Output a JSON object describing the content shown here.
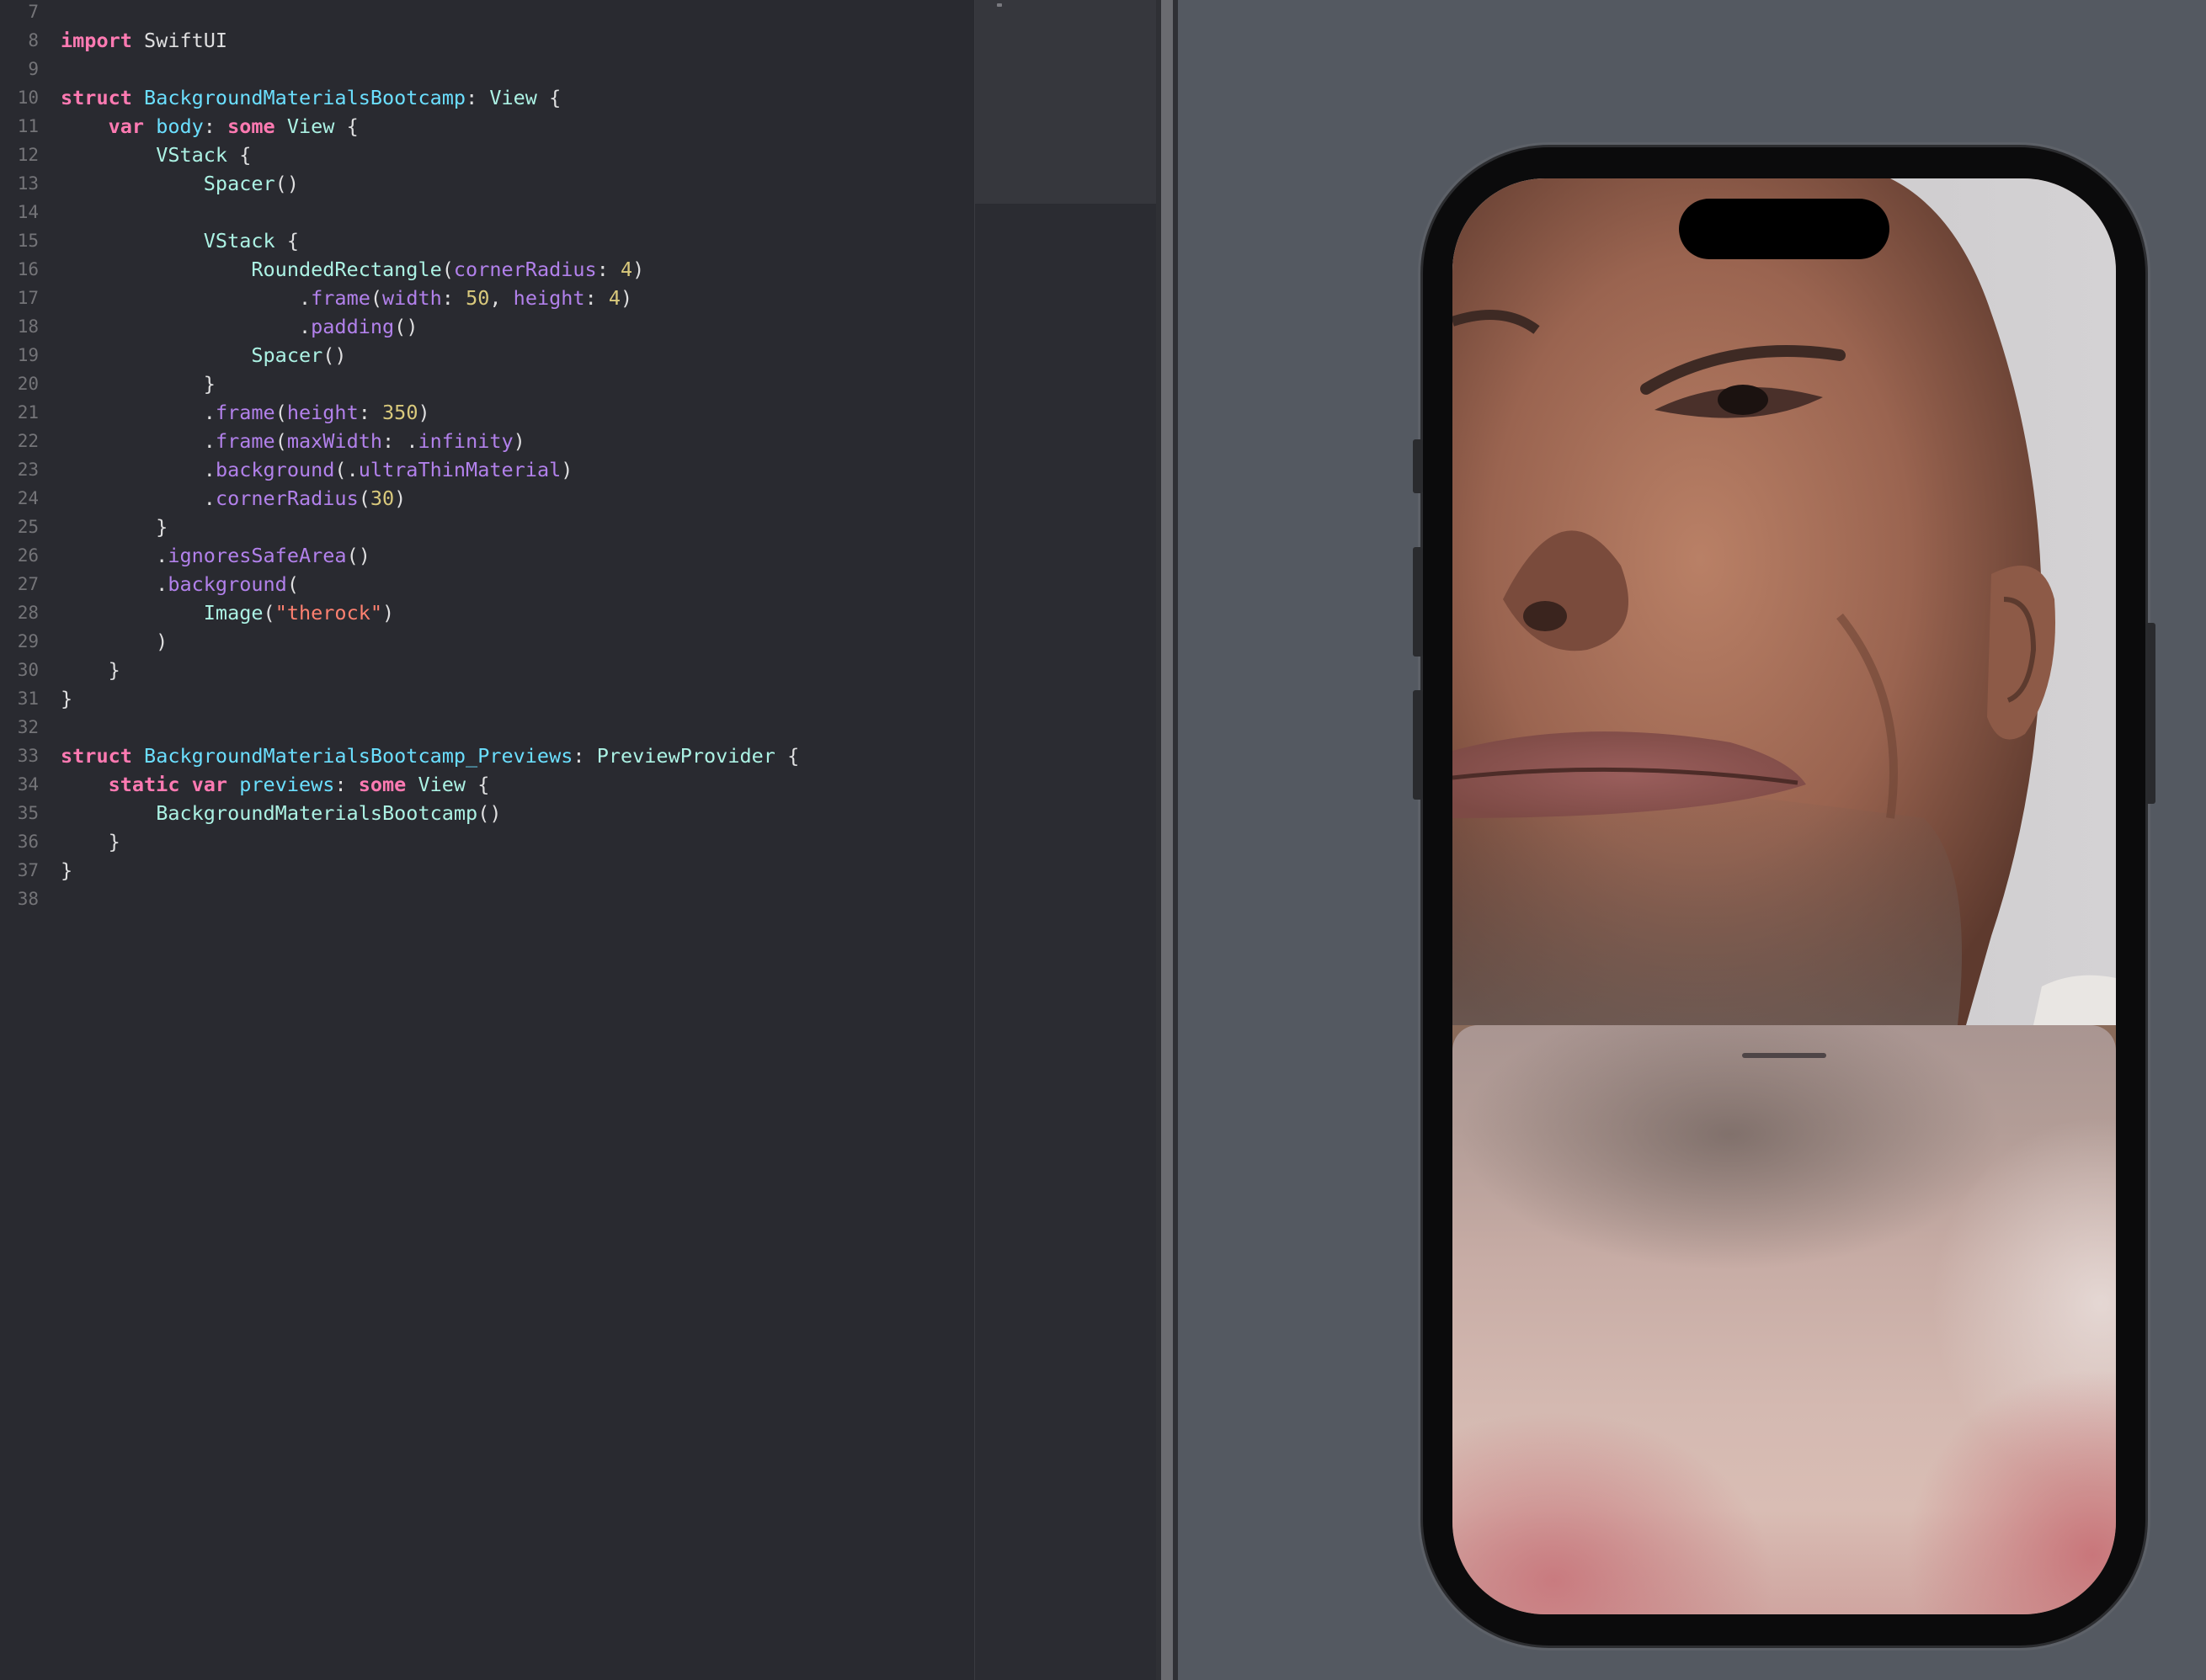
{
  "editor": {
    "lines": [
      {
        "n": "7",
        "tokens": []
      },
      {
        "n": "8",
        "tokens": [
          [
            "kw",
            "import"
          ],
          [
            "p",
            " SwiftUI"
          ]
        ]
      },
      {
        "n": "9",
        "tokens": []
      },
      {
        "n": "10",
        "tokens": [
          [
            "kw",
            "struct"
          ],
          [
            "p",
            " "
          ],
          [
            "tp",
            "BackgroundMaterialsBootcamp"
          ],
          [
            "p",
            ": "
          ],
          [
            "cls",
            "View"
          ],
          [
            "p",
            " {"
          ]
        ]
      },
      {
        "n": "11",
        "tokens": [
          [
            "p",
            "    "
          ],
          [
            "kw",
            "var"
          ],
          [
            "p",
            " "
          ],
          [
            "tp",
            "body"
          ],
          [
            "p",
            ": "
          ],
          [
            "kw",
            "some"
          ],
          [
            "p",
            " "
          ],
          [
            "cls",
            "View"
          ],
          [
            "p",
            " {"
          ]
        ]
      },
      {
        "n": "12",
        "tokens": [
          [
            "p",
            "        "
          ],
          [
            "cls",
            "VStack"
          ],
          [
            "p",
            " {"
          ]
        ]
      },
      {
        "n": "13",
        "tokens": [
          [
            "p",
            "            "
          ],
          [
            "cls",
            "Spacer"
          ],
          [
            "p",
            "()"
          ]
        ]
      },
      {
        "n": "14",
        "tokens": []
      },
      {
        "n": "15",
        "tokens": [
          [
            "p",
            "            "
          ],
          [
            "cls",
            "VStack"
          ],
          [
            "p",
            " {"
          ]
        ]
      },
      {
        "n": "16",
        "tokens": [
          [
            "p",
            "                "
          ],
          [
            "cls",
            "RoundedRectangle"
          ],
          [
            "p",
            "("
          ],
          [
            "mt",
            "cornerRadius"
          ],
          [
            "p",
            ": "
          ],
          [
            "num",
            "4"
          ],
          [
            "p",
            ")"
          ]
        ]
      },
      {
        "n": "17",
        "tokens": [
          [
            "p",
            "                    ."
          ],
          [
            "mt",
            "frame"
          ],
          [
            "p",
            "("
          ],
          [
            "mt",
            "width"
          ],
          [
            "p",
            ": "
          ],
          [
            "num",
            "50"
          ],
          [
            "p",
            ", "
          ],
          [
            "mt",
            "height"
          ],
          [
            "p",
            ": "
          ],
          [
            "num",
            "4"
          ],
          [
            "p",
            ")"
          ]
        ]
      },
      {
        "n": "18",
        "tokens": [
          [
            "p",
            "                    ."
          ],
          [
            "mt",
            "padding"
          ],
          [
            "p",
            "()"
          ]
        ]
      },
      {
        "n": "19",
        "tokens": [
          [
            "p",
            "                "
          ],
          [
            "cls",
            "Spacer"
          ],
          [
            "p",
            "()"
          ]
        ]
      },
      {
        "n": "20",
        "tokens": [
          [
            "p",
            "            }"
          ]
        ]
      },
      {
        "n": "21",
        "tokens": [
          [
            "p",
            "            ."
          ],
          [
            "mt",
            "frame"
          ],
          [
            "p",
            "("
          ],
          [
            "mt",
            "height"
          ],
          [
            "p",
            ": "
          ],
          [
            "num",
            "350"
          ],
          [
            "p",
            ")"
          ]
        ]
      },
      {
        "n": "22",
        "tokens": [
          [
            "p",
            "            ."
          ],
          [
            "mt",
            "frame"
          ],
          [
            "p",
            "("
          ],
          [
            "mt",
            "maxWidth"
          ],
          [
            "p",
            ": ."
          ],
          [
            "mt",
            "infinity"
          ],
          [
            "p",
            ")"
          ]
        ]
      },
      {
        "n": "23",
        "tokens": [
          [
            "p",
            "            ."
          ],
          [
            "mt",
            "background"
          ],
          [
            "p",
            "(."
          ],
          [
            "mt",
            "ultraThinMaterial"
          ],
          [
            "p",
            ")"
          ]
        ]
      },
      {
        "n": "24",
        "tokens": [
          [
            "p",
            "            ."
          ],
          [
            "mt",
            "cornerRadius"
          ],
          [
            "p",
            "("
          ],
          [
            "num",
            "30"
          ],
          [
            "p",
            ")"
          ]
        ]
      },
      {
        "n": "25",
        "tokens": [
          [
            "p",
            "        }"
          ]
        ]
      },
      {
        "n": "26",
        "tokens": [
          [
            "p",
            "        ."
          ],
          [
            "mt",
            "ignoresSafeArea"
          ],
          [
            "p",
            "()"
          ]
        ]
      },
      {
        "n": "27",
        "tokens": [
          [
            "p",
            "        ."
          ],
          [
            "mt",
            "background"
          ],
          [
            "p",
            "("
          ]
        ]
      },
      {
        "n": "28",
        "tokens": [
          [
            "p",
            "            "
          ],
          [
            "cls",
            "Image"
          ],
          [
            "p",
            "("
          ],
          [
            "str",
            "\"therock\""
          ],
          [
            "p",
            ")"
          ]
        ]
      },
      {
        "n": "29",
        "tokens": [
          [
            "p",
            "        )"
          ]
        ]
      },
      {
        "n": "30",
        "tokens": [
          [
            "p",
            "    }"
          ]
        ]
      },
      {
        "n": "31",
        "tokens": [
          [
            "p",
            "}"
          ]
        ]
      },
      {
        "n": "32",
        "tokens": []
      },
      {
        "n": "33",
        "tokens": [
          [
            "kw",
            "struct"
          ],
          [
            "p",
            " "
          ],
          [
            "tp",
            "BackgroundMaterialsBootcamp_Previews"
          ],
          [
            "p",
            ": "
          ],
          [
            "cls",
            "PreviewProvider"
          ],
          [
            "p",
            " {"
          ]
        ]
      },
      {
        "n": "34",
        "tokens": [
          [
            "p",
            "    "
          ],
          [
            "kw",
            "static"
          ],
          [
            "p",
            " "
          ],
          [
            "kw",
            "var"
          ],
          [
            "p",
            " "
          ],
          [
            "tp",
            "previews"
          ],
          [
            "p",
            ": "
          ],
          [
            "kw",
            "some"
          ],
          [
            "p",
            " "
          ],
          [
            "cls",
            "View"
          ],
          [
            "p",
            " {"
          ]
        ]
      },
      {
        "n": "35",
        "tokens": [
          [
            "p",
            "        "
          ],
          [
            "cls",
            "BackgroundMaterialsBootcamp"
          ],
          [
            "p",
            "()"
          ]
        ]
      },
      {
        "n": "36",
        "tokens": [
          [
            "p",
            "    }"
          ]
        ]
      },
      {
        "n": "37",
        "tokens": [
          [
            "p",
            "}"
          ]
        ]
      },
      {
        "n": "38",
        "tokens": []
      }
    ]
  },
  "preview": {
    "device": "iPhone",
    "background_image": "therock",
    "material": "ultraThinMaterial",
    "sheet_height_pt": 350,
    "sheet_corner_radius_pt": 30,
    "grabber_width_pt": 50,
    "grabber_height_pt": 4
  },
  "colors": {
    "editor_bg": "#292a30",
    "keyword": "#ff7ab2",
    "type_decl": "#6bdfff",
    "method": "#b281eb",
    "number": "#d9c97c",
    "string": "#ff8170",
    "class": "#acf2e4",
    "canvas_bg": "#545961"
  }
}
